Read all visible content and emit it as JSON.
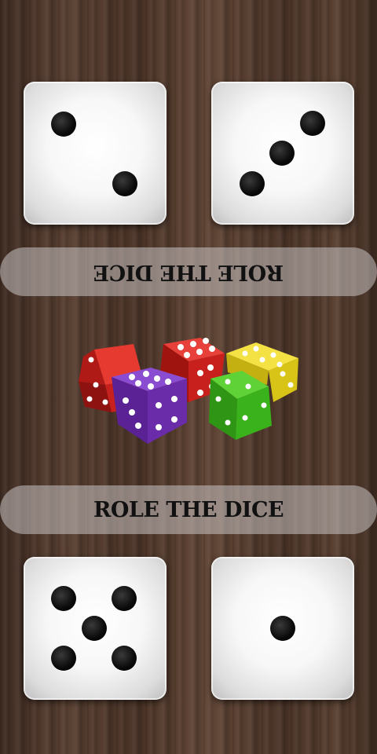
{
  "top_button": {
    "label": "ROLE THE DICE",
    "rotated": true
  },
  "bottom_button": {
    "label": "ROLE THE DICE"
  },
  "dice": {
    "top_left": {
      "value": 2
    },
    "top_right": {
      "value": 3
    },
    "bottom_left": {
      "value": 5
    },
    "bottom_right": {
      "value": 1
    }
  },
  "decoration": {
    "colored_dice": [
      "red",
      "purple",
      "red",
      "yellow",
      "green"
    ],
    "colors": {
      "red": "#c8201c",
      "purple": "#6a2ca8",
      "yellow": "#e4d21c",
      "green": "#3ab21c"
    }
  },
  "theme": {
    "wood": "#4f3729",
    "pill": "#c8c3c3"
  }
}
